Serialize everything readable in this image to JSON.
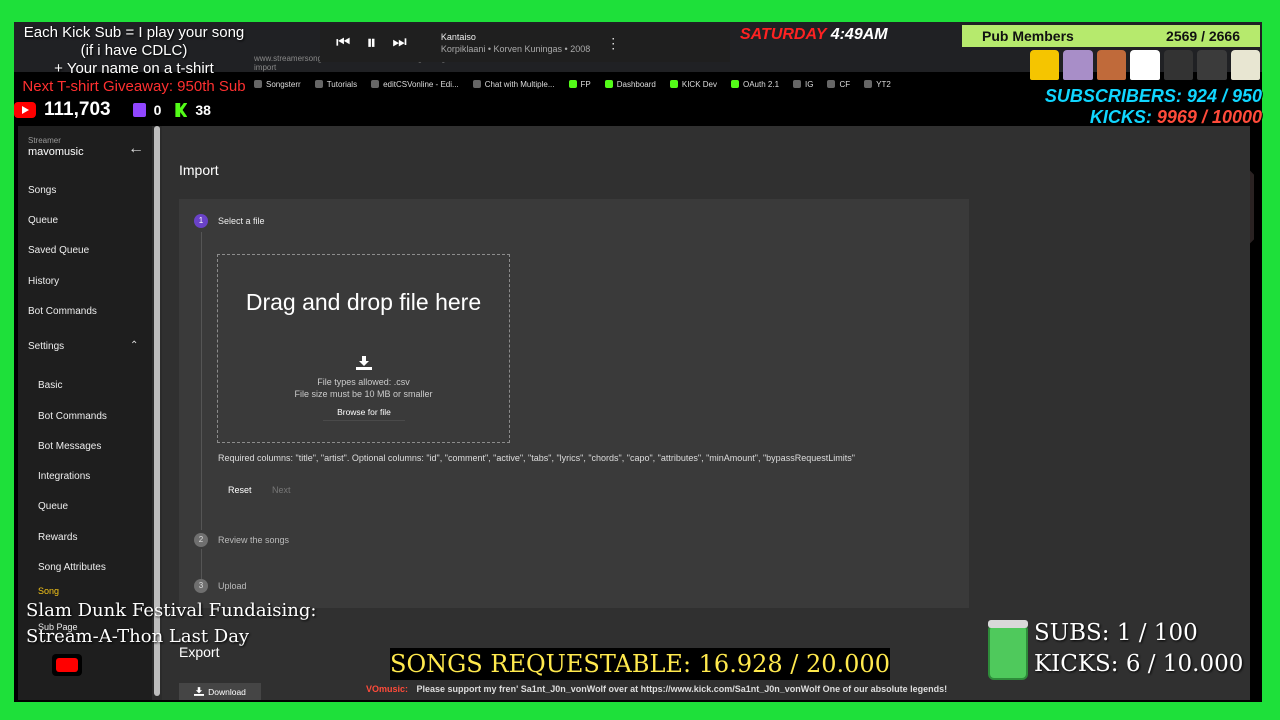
{
  "overlay": {
    "sub_line1": "Each Kick Sub = I play your song",
    "sub_line2": "(if i have CDLC)",
    "sub_line3": "+ Your name on a t-shirt",
    "sub_line4": "Next T-shirt Giveaway: 950th Sub",
    "youtube_count": "111,703",
    "twitch_count": "0",
    "kick_count": "38",
    "clock_day": "SATURDAY",
    "clock_time": "4:49AM",
    "pub_label": "Pub Members",
    "pub_value": "2569 / 2666",
    "subscribers_label": "SUBSCRIBERS:",
    "subscribers_value": "924 / 950",
    "kicks_label": "KICKS:",
    "kicks_value": "9969 / 10000",
    "fundraiser_line1": "Slam Dunk Festival Fundaising:",
    "fundraiser_line2": "Stream-A-Thon Last Day",
    "songs_requestable": "SONGS REQUESTABLE: 16.928 / 20.000",
    "ticker_tag": "VOmusic:",
    "ticker_text": "Please support my fren' Sa1nt_J0n_vonWolf over at https://www.kick.com/Sa1nt_J0n_vonWolf One of our absolute legends!",
    "subs_goal": "SUBS:  1 / 100",
    "kicks_goal": "KICKS: 6 / 10.000",
    "shirt_colors": [
      "#f5c500",
      "#a88ec8",
      "#c06a3a",
      "#ffffff",
      "#333333",
      "#3b3b3b",
      "#e8e6d2"
    ]
  },
  "player": {
    "title": "Kantaiso",
    "subtitle": "Korpiklaani • Korven Kuningas • 2008"
  },
  "browser": {
    "url": "www.streamersonglist.com/t/mavomusic/settings/song-import",
    "bookmarks": [
      "Songsterr",
      "Tutorials",
      "editCSVonline - Edi...",
      "Chat with Multiple...",
      "FP",
      "Dashboard",
      "KICK Dev",
      "OAuth 2.1",
      "IG",
      "CF",
      "YT2"
    ]
  },
  "sidebar": {
    "streamer_caption": "Streamer",
    "streamer_name": "mavomusic",
    "items": [
      "Songs",
      "Queue",
      "Saved Queue",
      "History",
      "Bot Commands",
      "Settings"
    ],
    "settings_items": [
      "Basic",
      "Bot Commands",
      "Bot Messages",
      "Integrations",
      "Queue",
      "Rewards",
      "Song Attributes",
      "Song",
      "Sub Page"
    ]
  },
  "main": {
    "title": "Import",
    "steps": [
      {
        "num": "1",
        "label": "Select a file"
      },
      {
        "num": "2",
        "label": "Review the songs"
      },
      {
        "num": "3",
        "label": "Upload"
      }
    ],
    "drop_title": "Drag and drop file here",
    "file_types": "File types allowed: .csv",
    "file_size": "File size must be 10 MB or smaller",
    "browse_label": "Browse for file",
    "required_columns": "Required columns: \"title\", \"artist\". Optional columns: \"id\", \"comment\", \"active\", \"tabs\", \"lyrics\", \"chords\", \"capo\", \"attributes\", \"minAmount\", \"bypassRequestLimits\"",
    "reset_label": "Reset",
    "next_label": "Next",
    "export_title": "Export",
    "download_label": "Download"
  }
}
